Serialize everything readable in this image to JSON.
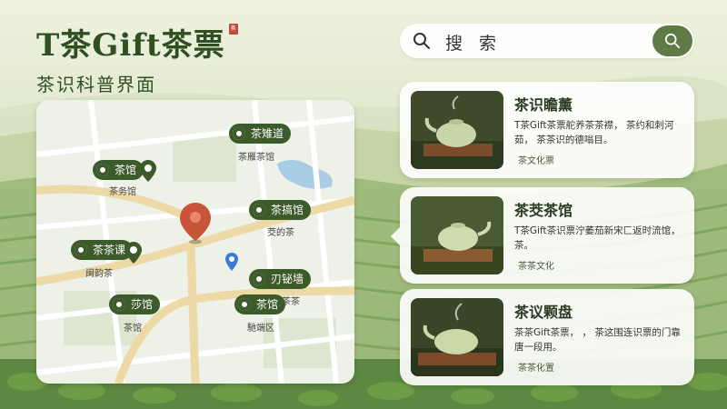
{
  "brand": {
    "title": "T茶Gift茶票",
    "seal": "茶",
    "subtitle": "茶识科普界面"
  },
  "search": {
    "label": "搜 索",
    "icon": "search-icon",
    "button_icon": "search-icon"
  },
  "map": {
    "pins": [
      {
        "label": "茶雉道",
        "caption": "茶雁茶馆"
      },
      {
        "label": "茶馆",
        "caption": "茶务馆"
      },
      {
        "label": "茶搞馆",
        "caption": "茭的茶"
      },
      {
        "label": "茶茶课",
        "caption": "闽韵茶"
      },
      {
        "label": "刃铋墙",
        "caption": "茶茶"
      },
      {
        "label": "莎馆",
        "caption": "茶馆"
      },
      {
        "label": "茶馆",
        "caption": "馳端区"
      }
    ]
  },
  "cards": [
    {
      "title": "茶识瞻薰",
      "desc": "T茶Gift茶票舵养茶茶襟， 茶约和刺河茹， 茶茶识的德嗡目。",
      "tag": "茶文化票"
    },
    {
      "title": "茶茭茶馆",
      "desc": "T茶Gift茶识票泞萎茄新宋匚返时流馆， 茶。",
      "tag": "茶茶文化"
    },
    {
      "title": "茶议颗盘",
      "desc": "茶茶Gift茶票， ， 茶这围连识票的门靠唐一段用。",
      "tag": "茶茶化置"
    }
  ],
  "colors": {
    "brand_green": "#2f4f22",
    "pin_green": "#3d5a2b",
    "search_button": "#5f7a45",
    "main_marker": "#c8553a",
    "location_marker": "#3a7bd5"
  }
}
